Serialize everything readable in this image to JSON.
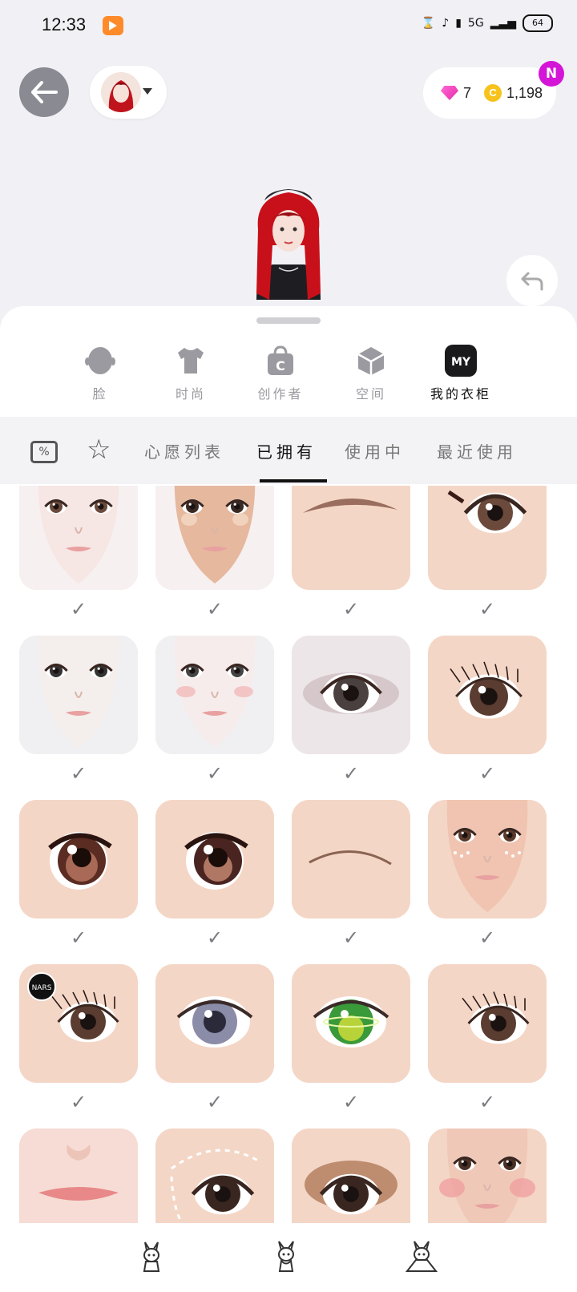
{
  "status_bar": {
    "time": "12:33",
    "network": "5G",
    "battery": "64"
  },
  "wallet": {
    "gems": "7",
    "coins": "1,198",
    "coin_symbol": "C",
    "notification_badge": "N"
  },
  "categories": [
    {
      "label": "脸",
      "icon": "face-icon"
    },
    {
      "label": "时尚",
      "icon": "shirt-icon"
    },
    {
      "label": "创作者",
      "icon": "creator-bag-icon"
    },
    {
      "label": "空间",
      "icon": "space-cube-icon"
    },
    {
      "label": "我的衣柜",
      "icon": "my-closet-icon",
      "icon_text": "MY",
      "active": true
    }
  ],
  "sub_tabs": [
    {
      "label": "心愿列表"
    },
    {
      "label": "已拥有",
      "active": true
    },
    {
      "label": "使用中"
    },
    {
      "label": "最近使用"
    }
  ],
  "discount_icon_text": "%",
  "items": [
    {
      "kind": "face-pale",
      "owned_mark": "✓"
    },
    {
      "kind": "face-contour",
      "owned_mark": "✓"
    },
    {
      "kind": "eyebrow-thick",
      "owned_mark": "✓"
    },
    {
      "kind": "eye-winged",
      "owned_mark": "✓"
    },
    {
      "kind": "face-white",
      "owned_mark": "✓"
    },
    {
      "kind": "face-white-blush",
      "owned_mark": "✓"
    },
    {
      "kind": "eye-smoky",
      "owned_mark": "✓"
    },
    {
      "kind": "eye-lashes",
      "owned_mark": "✓"
    },
    {
      "kind": "eye-anime-brown",
      "owned_mark": "✓"
    },
    {
      "kind": "eye-anime-brown-2",
      "owned_mark": "✓"
    },
    {
      "kind": "eyebrow-thin",
      "owned_mark": "✓"
    },
    {
      "kind": "face-freckles",
      "owned_mark": "✓"
    },
    {
      "kind": "eye-nars-lashes",
      "owned_mark": "✓",
      "brand": "NARS"
    },
    {
      "kind": "eye-silver",
      "owned_mark": "✓"
    },
    {
      "kind": "eye-green-galaxy",
      "owned_mark": "✓"
    },
    {
      "kind": "eye-lashes-2",
      "owned_mark": "✓"
    },
    {
      "kind": "lips-nose",
      "owned_mark": ""
    },
    {
      "kind": "eye-dotted-liner",
      "owned_mark": ""
    },
    {
      "kind": "eye-brown-shadow",
      "owned_mark": ""
    },
    {
      "kind": "face-blush-dots",
      "owned_mark": ""
    }
  ],
  "colors": {
    "accent_pink": "#d414d6",
    "gem": "#e52aa8",
    "coin": "#f7c21c",
    "skin": "#f4d6c6"
  }
}
